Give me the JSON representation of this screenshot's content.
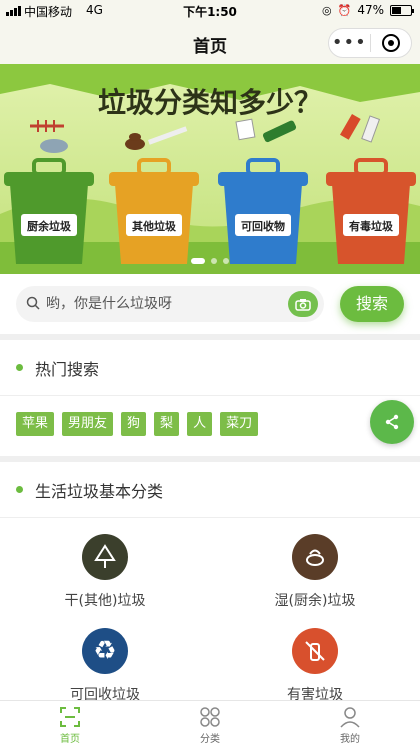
{
  "status_bar": {
    "carrier": "中国移动",
    "network": "4G",
    "time": "下午1:50",
    "battery": "47%",
    "battery_level": 0.47
  },
  "nav": {
    "title": "首页"
  },
  "banner": {
    "headline": "垃圾分类知多少？",
    "bins": [
      {
        "label": "厨余垃圾",
        "color": "#4f9a2c"
      },
      {
        "label": "其他垃圾",
        "color": "#e6a224"
      },
      {
        "label": "可回收物",
        "color": "#2f7ccc"
      },
      {
        "label": "有毒垃圾",
        "color": "#d7542c"
      }
    ],
    "slide_count": 3,
    "active_slide": 1
  },
  "search": {
    "placeholder": "哟，你是什么垃圾呀",
    "button_label": "搜索"
  },
  "hot": {
    "title": "热门搜索",
    "tags": [
      "苹果",
      "男朋友",
      "狗",
      "梨",
      "人",
      "菜刀"
    ]
  },
  "basic": {
    "title": "生活垃圾基本分类",
    "categories": [
      {
        "name": "干(其他)垃圾",
        "icon": "tree-icon",
        "color": "#3b3f2c"
      },
      {
        "name": "湿(厨余)垃圾",
        "icon": "food-waste-icon",
        "color": "#5a3d28"
      },
      {
        "name": "可回收垃圾",
        "icon": "recycle-icon",
        "color": "#1e4e86"
      },
      {
        "name": "有害垃圾",
        "icon": "hazard-icon",
        "color": "#d8502d"
      }
    ]
  },
  "tabs": [
    {
      "label": "首页",
      "icon": "home-scan-icon",
      "active": true
    },
    {
      "label": "分类",
      "icon": "grid-icon",
      "active": false
    },
    {
      "label": "我的",
      "icon": "user-icon",
      "active": false
    }
  ],
  "colors": {
    "accent": "#6cbc3f",
    "tag": "#7dbd48",
    "bar": "#f6f6ee"
  }
}
